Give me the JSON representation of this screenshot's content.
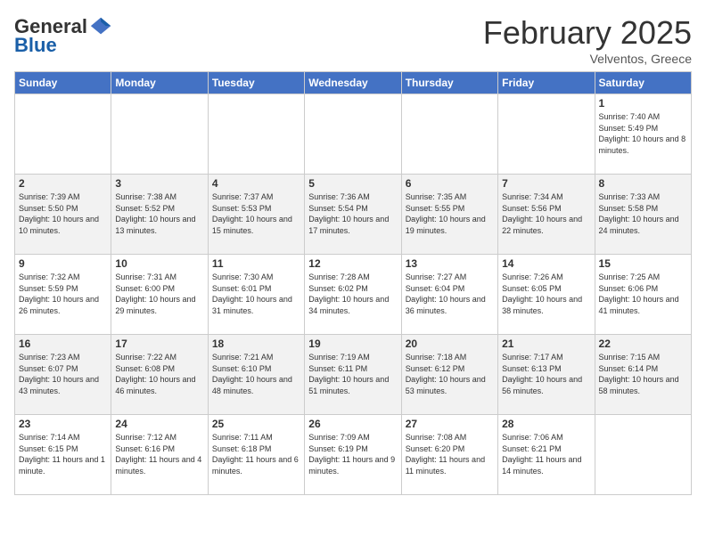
{
  "header": {
    "logo_general": "General",
    "logo_blue": "Blue",
    "month_title": "February 2025",
    "location": "Velventos, Greece"
  },
  "weekdays": [
    "Sunday",
    "Monday",
    "Tuesday",
    "Wednesday",
    "Thursday",
    "Friday",
    "Saturday"
  ],
  "weeks": [
    [
      {
        "day": "",
        "info": ""
      },
      {
        "day": "",
        "info": ""
      },
      {
        "day": "",
        "info": ""
      },
      {
        "day": "",
        "info": ""
      },
      {
        "day": "",
        "info": ""
      },
      {
        "day": "",
        "info": ""
      },
      {
        "day": "1",
        "info": "Sunrise: 7:40 AM\nSunset: 5:49 PM\nDaylight: 10 hours and 8 minutes."
      }
    ],
    [
      {
        "day": "2",
        "info": "Sunrise: 7:39 AM\nSunset: 5:50 PM\nDaylight: 10 hours and 10 minutes."
      },
      {
        "day": "3",
        "info": "Sunrise: 7:38 AM\nSunset: 5:52 PM\nDaylight: 10 hours and 13 minutes."
      },
      {
        "day": "4",
        "info": "Sunrise: 7:37 AM\nSunset: 5:53 PM\nDaylight: 10 hours and 15 minutes."
      },
      {
        "day": "5",
        "info": "Sunrise: 7:36 AM\nSunset: 5:54 PM\nDaylight: 10 hours and 17 minutes."
      },
      {
        "day": "6",
        "info": "Sunrise: 7:35 AM\nSunset: 5:55 PM\nDaylight: 10 hours and 19 minutes."
      },
      {
        "day": "7",
        "info": "Sunrise: 7:34 AM\nSunset: 5:56 PM\nDaylight: 10 hours and 22 minutes."
      },
      {
        "day": "8",
        "info": "Sunrise: 7:33 AM\nSunset: 5:58 PM\nDaylight: 10 hours and 24 minutes."
      }
    ],
    [
      {
        "day": "9",
        "info": "Sunrise: 7:32 AM\nSunset: 5:59 PM\nDaylight: 10 hours and 26 minutes."
      },
      {
        "day": "10",
        "info": "Sunrise: 7:31 AM\nSunset: 6:00 PM\nDaylight: 10 hours and 29 minutes."
      },
      {
        "day": "11",
        "info": "Sunrise: 7:30 AM\nSunset: 6:01 PM\nDaylight: 10 hours and 31 minutes."
      },
      {
        "day": "12",
        "info": "Sunrise: 7:28 AM\nSunset: 6:02 PM\nDaylight: 10 hours and 34 minutes."
      },
      {
        "day": "13",
        "info": "Sunrise: 7:27 AM\nSunset: 6:04 PM\nDaylight: 10 hours and 36 minutes."
      },
      {
        "day": "14",
        "info": "Sunrise: 7:26 AM\nSunset: 6:05 PM\nDaylight: 10 hours and 38 minutes."
      },
      {
        "day": "15",
        "info": "Sunrise: 7:25 AM\nSunset: 6:06 PM\nDaylight: 10 hours and 41 minutes."
      }
    ],
    [
      {
        "day": "16",
        "info": "Sunrise: 7:23 AM\nSunset: 6:07 PM\nDaylight: 10 hours and 43 minutes."
      },
      {
        "day": "17",
        "info": "Sunrise: 7:22 AM\nSunset: 6:08 PM\nDaylight: 10 hours and 46 minutes."
      },
      {
        "day": "18",
        "info": "Sunrise: 7:21 AM\nSunset: 6:10 PM\nDaylight: 10 hours and 48 minutes."
      },
      {
        "day": "19",
        "info": "Sunrise: 7:19 AM\nSunset: 6:11 PM\nDaylight: 10 hours and 51 minutes."
      },
      {
        "day": "20",
        "info": "Sunrise: 7:18 AM\nSunset: 6:12 PM\nDaylight: 10 hours and 53 minutes."
      },
      {
        "day": "21",
        "info": "Sunrise: 7:17 AM\nSunset: 6:13 PM\nDaylight: 10 hours and 56 minutes."
      },
      {
        "day": "22",
        "info": "Sunrise: 7:15 AM\nSunset: 6:14 PM\nDaylight: 10 hours and 58 minutes."
      }
    ],
    [
      {
        "day": "23",
        "info": "Sunrise: 7:14 AM\nSunset: 6:15 PM\nDaylight: 11 hours and 1 minute."
      },
      {
        "day": "24",
        "info": "Sunrise: 7:12 AM\nSunset: 6:16 PM\nDaylight: 11 hours and 4 minutes."
      },
      {
        "day": "25",
        "info": "Sunrise: 7:11 AM\nSunset: 6:18 PM\nDaylight: 11 hours and 6 minutes."
      },
      {
        "day": "26",
        "info": "Sunrise: 7:09 AM\nSunset: 6:19 PM\nDaylight: 11 hours and 9 minutes."
      },
      {
        "day": "27",
        "info": "Sunrise: 7:08 AM\nSunset: 6:20 PM\nDaylight: 11 hours and 11 minutes."
      },
      {
        "day": "28",
        "info": "Sunrise: 7:06 AM\nSunset: 6:21 PM\nDaylight: 11 hours and 14 minutes."
      },
      {
        "day": "",
        "info": ""
      }
    ]
  ]
}
